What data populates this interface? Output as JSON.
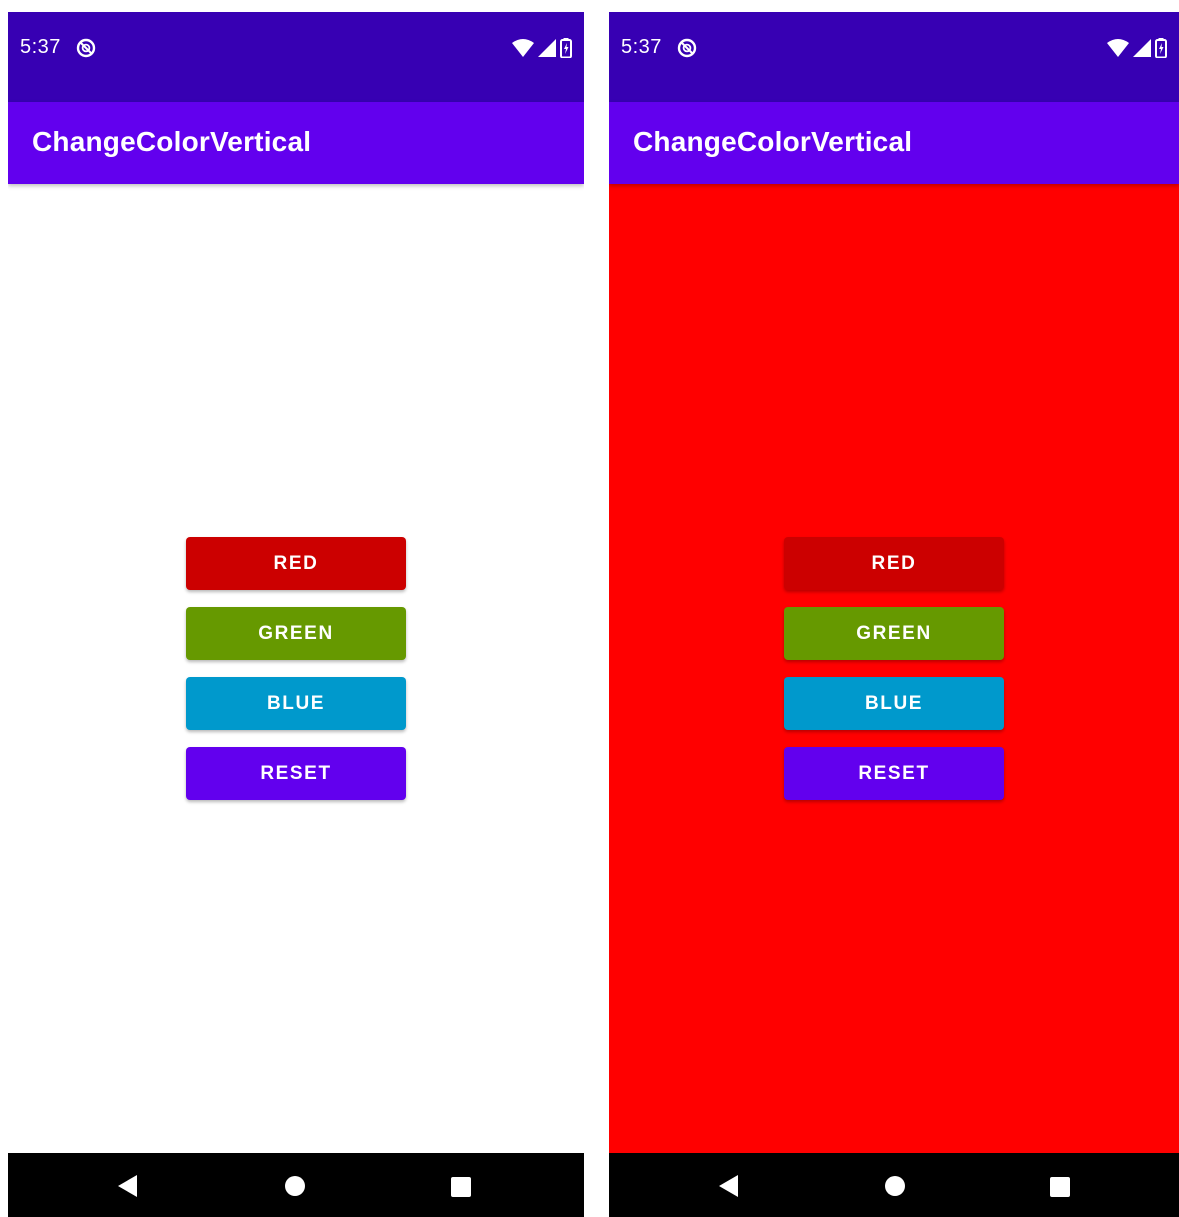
{
  "app_title": "ChangeColorVertical",
  "status_time": "5:37",
  "colors": {
    "status_bar": "#3700B3",
    "app_bar": "#6200EE",
    "nav_bar": "#000000",
    "red_button": "#CC0000",
    "green_button": "#669900",
    "blue_button": "#0099CC",
    "reset_button": "#6200EE",
    "left_background": "#FFFFFF",
    "right_background": "#FF0000"
  },
  "buttons": {
    "red": "RED",
    "green": "GREEN",
    "blue": "BLUE",
    "reset": "RESET"
  },
  "icons": {
    "status": [
      "do-not-disturb-icon",
      "wifi-icon",
      "cell-signal-icon",
      "battery-charging-icon"
    ],
    "nav": [
      "back-icon",
      "home-icon",
      "recents-icon"
    ]
  }
}
